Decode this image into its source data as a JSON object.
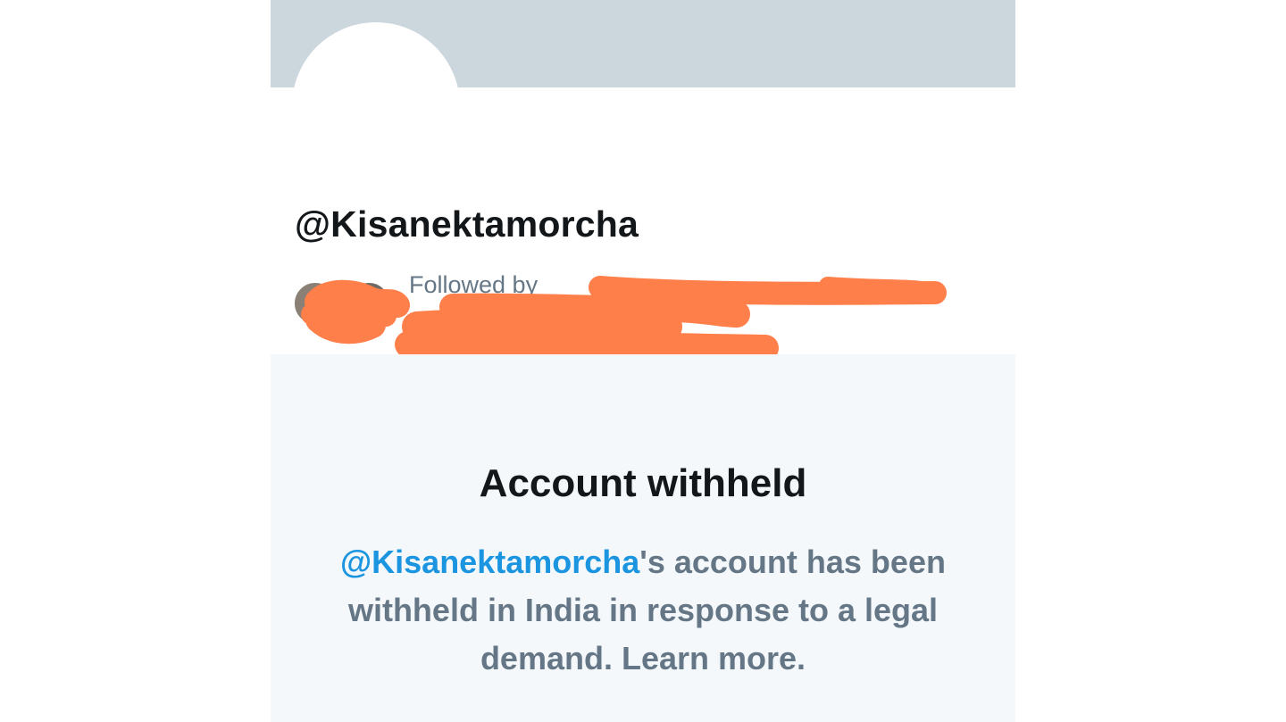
{
  "profile": {
    "handle": "@Kisanektamorcha",
    "followed_by_prefix": "Followed by ",
    "followed_by_trailing": ","
  },
  "withheld": {
    "title": "Account withheld",
    "mention": "@Kisanektamorcha",
    "message_part1": "'s account has been withheld in India in response to a legal demand. ",
    "learn_more": "Learn more."
  },
  "colors": {
    "banner": "#ccd6dd",
    "text_primary": "#14171a",
    "text_secondary": "#657786",
    "link": "#1b95e0",
    "withheld_background": "#f5f8fa",
    "redaction": "#ff7f4a"
  }
}
